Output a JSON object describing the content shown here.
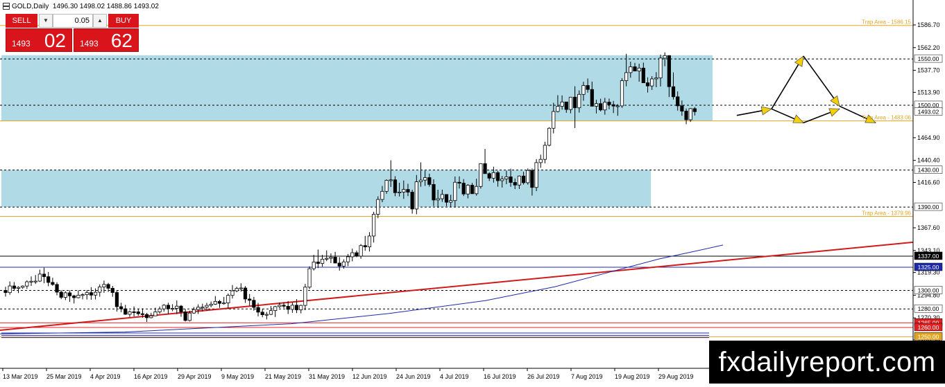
{
  "header": {
    "symbol": "GOLD,Daily",
    "open": "1496.30",
    "high": "1498.02",
    "low": "1488.86",
    "close": "1493.02"
  },
  "trade_panel": {
    "sell_label": "SELL",
    "buy_label": "BUY",
    "lot": "0.05",
    "down_arrow": "▼",
    "up_arrow": "▲",
    "bid_small": "1493",
    "bid_big": "02",
    "ask_small": "1493",
    "ask_big": "62"
  },
  "colors": {
    "sell_buy": "#d9141b",
    "zone": "#add8e6",
    "trend": "#d11a1a",
    "ma": "#1c2aa8",
    "trap": "#e3a520",
    "level_black": "#000000",
    "level_blue": "#1c2aa8",
    "level_red": "#e02020",
    "arrow": "#f5d000"
  },
  "chart_data": {
    "type": "candlestick",
    "symbol": "GOLD",
    "timeframe": "Daily",
    "ylim": [
      1242,
      1600
    ],
    "y_ticks": [
      "1586.70",
      "1562.20",
      "1537.70",
      "1513.90",
      "1464.90",
      "1440.40",
      "1416.60",
      "1367.60",
      "1343.10",
      "1319.30",
      "1294.80",
      "1270.30",
      "1246.50"
    ],
    "x_ticks": [
      "13 Mar 2019",
      "25 Mar 2019",
      "4 Apr 2019",
      "16 Apr 2019",
      "29 Apr 2019",
      "9 May 2019",
      "21 May 2019",
      "31 May 2019",
      "12 Jun 2019",
      "24 Jun 2019",
      "4 Jul 2019",
      "16 Jul 2019",
      "26 Jul 2019",
      "7 Aug 2019",
      "19 Aug 2019",
      "29 Aug 2019"
    ],
    "current_price": "1493.02",
    "levels": [
      {
        "value": 1550.0,
        "label": "1550.00",
        "color": "black",
        "style": "dashed"
      },
      {
        "value": 1500.0,
        "label": "1500.00",
        "color": "black",
        "style": "dashed"
      },
      {
        "value": 1430.0,
        "label": "1430.00",
        "color": "black",
        "style": "dashed"
      },
      {
        "value": 1390.0,
        "label": "1390.00",
        "color": "black",
        "style": "dashed"
      },
      {
        "value": 1337.0,
        "label": "1337.00",
        "color": "black",
        "style": "solid"
      },
      {
        "value": 1325.0,
        "label": "1325.00",
        "color": "blue",
        "style": "solid"
      },
      {
        "value": 1300.0,
        "label": "1300.00",
        "color": "black",
        "style": "dashed"
      },
      {
        "value": 1280.0,
        "label": "1280.00",
        "color": "black",
        "style": "dashed"
      },
      {
        "value": 1265.0,
        "label": "1265.00",
        "color": "red",
        "style": "solid"
      },
      {
        "value": 1260.0,
        "label": "1260.00",
        "color": "red",
        "style": "solid"
      },
      {
        "value": 1250.0,
        "label": "1250.00",
        "color": "trap",
        "style": "solid"
      }
    ],
    "trap_areas": [
      {
        "value": 1586.15,
        "label": "Trap Area - 1586.15"
      },
      {
        "value": 1483.06,
        "label": "Trap Area - 1483.06"
      },
      {
        "value": 1379.96,
        "label": "Trap Area - 1379.96"
      }
    ],
    "zones": [
      {
        "from": 1483.06,
        "to": 1554.0,
        "x_end": 1027
      },
      {
        "from": 1390.0,
        "to": 1430.0,
        "x_end": 938
      }
    ],
    "trendline": {
      "x1": 0,
      "y1": 1257,
      "x2": 1316,
      "y2": 1352
    },
    "moving_average": [
      [
        0,
        1253
      ],
      [
        180,
        1255
      ],
      [
        420,
        1264
      ],
      [
        560,
        1275
      ],
      [
        700,
        1289
      ],
      [
        800,
        1304
      ],
      [
        880,
        1320
      ],
      [
        950,
        1334
      ],
      [
        1000,
        1342
      ],
      [
        1042,
        1349
      ]
    ],
    "projection": [
      [
        1062,
        1489
      ],
      [
        1112,
        1496
      ],
      [
        1158,
        1553
      ],
      [
        1210,
        1499
      ],
      [
        1262,
        1481
      ]
    ],
    "projection_alt": [
      [
        1112,
        1496
      ],
      [
        1158,
        1481
      ],
      [
        1210,
        1496
      ]
    ],
    "candles": [
      [
        1300.0,
        1303.9,
        1293.3,
        1297.6
      ],
      [
        1297.6,
        1309.7,
        1295.3,
        1304.8
      ],
      [
        1304.8,
        1309.0,
        1300.2,
        1302.2
      ],
      [
        1302.2,
        1304.5,
        1297.1,
        1303.3
      ],
      [
        1303.3,
        1305.4,
        1301.7,
        1304.7
      ],
      [
        1304.7,
        1310.8,
        1301.6,
        1309.3
      ],
      [
        1309.3,
        1315.1,
        1304.8,
        1309.9
      ],
      [
        1309.9,
        1316.6,
        1306.9,
        1310.0
      ],
      [
        1310.0,
        1322.4,
        1309.1,
        1317.6
      ],
      [
        1317.6,
        1324.5,
        1307.7,
        1314.8
      ],
      [
        1314.8,
        1319.9,
        1304.5,
        1308.6
      ],
      [
        1308.6,
        1313.6,
        1304.9,
        1306.4
      ],
      [
        1306.4,
        1308.8,
        1294.7,
        1298.1
      ],
      [
        1298.1,
        1300.1,
        1290.5,
        1292.5
      ],
      [
        1292.5,
        1299.1,
        1289.5,
        1297.4
      ],
      [
        1297.4,
        1300.1,
        1287.5,
        1294.1
      ],
      [
        1294.1,
        1295.3,
        1285.9,
        1292.1
      ],
      [
        1292.1,
        1300.1,
        1291.4,
        1294.8
      ],
      [
        1294.8,
        1296.9,
        1290.3,
        1295.4
      ],
      [
        1295.4,
        1300.2,
        1290.2,
        1297.6
      ],
      [
        1297.6,
        1303.5,
        1289.9,
        1294.9
      ],
      [
        1294.9,
        1302.2,
        1290.2,
        1298.0
      ],
      [
        1298.0,
        1306.5,
        1293.2,
        1303.7
      ],
      [
        1303.7,
        1310.6,
        1297.3,
        1306.4
      ],
      [
        1306.4,
        1308.1,
        1298.4,
        1302.3
      ],
      [
        1302.3,
        1304.8,
        1293.1,
        1297.7
      ],
      [
        1297.7,
        1300.2,
        1277.2,
        1282.4
      ],
      [
        1282.4,
        1286.6,
        1276.5,
        1280.1
      ],
      [
        1280.1,
        1284.4,
        1273.6,
        1274.2
      ],
      [
        1274.2,
        1278.4,
        1271.4,
        1276.9
      ],
      [
        1276.9,
        1282.7,
        1271.8,
        1276.8
      ],
      [
        1276.8,
        1279.8,
        1272.6,
        1274.8
      ],
      [
        1274.8,
        1280.6,
        1270.6,
        1274.0
      ],
      [
        1274.0,
        1275.7,
        1265.9,
        1270.5
      ],
      [
        1270.5,
        1275.8,
        1269.8,
        1272.5
      ],
      [
        1272.5,
        1281.3,
        1272.2,
        1276.8
      ],
      [
        1276.8,
        1282.6,
        1274.9,
        1280.0
      ],
      [
        1280.0,
        1285.1,
        1277.0,
        1284.0
      ],
      [
        1284.0,
        1286.7,
        1274.3,
        1280.1
      ],
      [
        1280.1,
        1285.1,
        1277.5,
        1280.6
      ],
      [
        1280.6,
        1289.1,
        1274.4,
        1283.0
      ],
      [
        1283.0,
        1284.2,
        1271.5,
        1276.8
      ],
      [
        1276.8,
        1279.8,
        1266.4,
        1267.5
      ],
      [
        1267.5,
        1278.0,
        1266.4,
        1275.5
      ],
      [
        1275.5,
        1282.0,
        1274.8,
        1279.3
      ],
      [
        1279.3,
        1284.9,
        1274.5,
        1281.8
      ],
      [
        1281.8,
        1285.6,
        1277.4,
        1281.9
      ],
      [
        1281.9,
        1286.5,
        1278.1,
        1283.8
      ],
      [
        1283.8,
        1288.0,
        1281.8,
        1285.1
      ],
      [
        1285.1,
        1293.9,
        1284.4,
        1288.1
      ],
      [
        1288.1,
        1289.7,
        1281.2,
        1286.0
      ],
      [
        1286.0,
        1292.9,
        1284.5,
        1286.5
      ],
      [
        1286.5,
        1296.6,
        1279.8,
        1294.6
      ],
      [
        1294.6,
        1305.8,
        1291.2,
        1299.5
      ],
      [
        1299.5,
        1303.9,
        1298.0,
        1302.1
      ],
      [
        1302.1,
        1307.6,
        1298.7,
        1302.6
      ],
      [
        1302.6,
        1304.7,
        1286.6,
        1290.7
      ],
      [
        1290.7,
        1296.1,
        1283.5,
        1289.3
      ],
      [
        1289.3,
        1293.0,
        1278.1,
        1281.6
      ],
      [
        1281.6,
        1286.5,
        1271.9,
        1276.5
      ],
      [
        1276.5,
        1279.6,
        1271.0,
        1273.7
      ],
      [
        1273.7,
        1276.7,
        1268.7,
        1274.1
      ],
      [
        1274.1,
        1283.1,
        1273.3,
        1278.2
      ],
      [
        1278.2,
        1283.4,
        1271.3,
        1282.5
      ],
      [
        1282.5,
        1286.8,
        1280.9,
        1284.0
      ],
      [
        1284.0,
        1287.2,
        1280.9,
        1282.9
      ],
      [
        1282.9,
        1288.5,
        1274.5,
        1279.5
      ],
      [
        1279.5,
        1287.0,
        1275.8,
        1284.0
      ],
      [
        1284.0,
        1290.5,
        1275.5,
        1279.0
      ],
      [
        1279.0,
        1284.6,
        1275.2,
        1283.8
      ],
      [
        1283.8,
        1307.0,
        1278.6,
        1303.5
      ],
      [
        1303.5,
        1326.0,
        1301.5,
        1323.4
      ],
      [
        1323.4,
        1338.4,
        1321.5,
        1330.7
      ],
      [
        1330.7,
        1344.1,
        1324.1,
        1329.0
      ],
      [
        1329.0,
        1338.4,
        1325.6,
        1333.7
      ],
      [
        1333.7,
        1343.2,
        1331.6,
        1334.6
      ],
      [
        1334.6,
        1339.9,
        1329.5,
        1335.9
      ],
      [
        1335.9,
        1341.6,
        1330.3,
        1329.5
      ],
      [
        1329.5,
        1335.9,
        1321.4,
        1326.2
      ],
      [
        1326.2,
        1333.5,
        1323.4,
        1330.8
      ],
      [
        1330.8,
        1339.3,
        1326.2,
        1336.3
      ],
      [
        1336.3,
        1345.0,
        1331.4,
        1340.7
      ],
      [
        1340.7,
        1343.0,
        1335.9,
        1337.0
      ],
      [
        1337.0,
        1350.1,
        1334.2,
        1348.4
      ],
      [
        1348.4,
        1358.8,
        1342.7,
        1347.0
      ],
      [
        1347.0,
        1362.9,
        1342.0,
        1358.7
      ],
      [
        1358.7,
        1384.9,
        1351.7,
        1382.2
      ],
      [
        1382.2,
        1401.6,
        1378.0,
        1398.2
      ],
      [
        1398.2,
        1412.8,
        1395.2,
        1407.0
      ],
      [
        1407.0,
        1419.9,
        1404.3,
        1418.9
      ],
      [
        1418.9,
        1440.5,
        1411.7,
        1419.4
      ],
      [
        1419.4,
        1423.3,
        1401.7,
        1405.5
      ],
      [
        1405.5,
        1416.2,
        1401.4,
        1406.2
      ],
      [
        1406.2,
        1418.7,
        1398.8,
        1409.0
      ],
      [
        1409.0,
        1415.1,
        1401.8,
        1406.1
      ],
      [
        1406.1,
        1408.7,
        1382.9,
        1387.9
      ],
      [
        1387.9,
        1424.6,
        1382.2,
        1417.3
      ],
      [
        1417.3,
        1438.3,
        1412.0,
        1419.1
      ],
      [
        1419.1,
        1429.3,
        1412.9,
        1421.8
      ],
      [
        1421.8,
        1426.1,
        1412.0,
        1414.4
      ],
      [
        1414.4,
        1420.0,
        1391.1,
        1397.6
      ],
      [
        1397.6,
        1408.7,
        1389.2,
        1399.0
      ],
      [
        1399.0,
        1408.8,
        1395.6,
        1403.6
      ],
      [
        1403.6,
        1403.2,
        1390.9,
        1395.2
      ],
      [
        1395.2,
        1403.3,
        1390.2,
        1397.0
      ],
      [
        1397.0,
        1423.0,
        1390.4,
        1416.8
      ],
      [
        1416.8,
        1423.1,
        1410.0,
        1415.8
      ],
      [
        1415.8,
        1420.2,
        1401.9,
        1404.1
      ],
      [
        1404.1,
        1414.7,
        1399.4,
        1413.6
      ],
      [
        1413.6,
        1416.1,
        1406.7,
        1404.4
      ],
      [
        1404.4,
        1420.6,
        1402.3,
        1412.3
      ],
      [
        1412.3,
        1437.3,
        1410.0,
        1436.9
      ],
      [
        1436.9,
        1452.8,
        1431.6,
        1426.1
      ],
      [
        1426.1,
        1427.4,
        1418.2,
        1421.2
      ],
      [
        1421.2,
        1433.6,
        1416.4,
        1427.2
      ],
      [
        1427.2,
        1429.0,
        1412.0,
        1418.5
      ],
      [
        1418.5,
        1423.6,
        1411.1,
        1420.4
      ],
      [
        1420.4,
        1429.3,
        1414.7,
        1422.6
      ],
      [
        1422.6,
        1431.4,
        1411.9,
        1416.6
      ],
      [
        1416.6,
        1420.9,
        1409.4,
        1413.8
      ],
      [
        1413.8,
        1424.1,
        1409.5,
        1423.5
      ],
      [
        1423.5,
        1428.2,
        1414.3,
        1416.3
      ],
      [
        1416.3,
        1431.7,
        1414.2,
        1429.5
      ],
      [
        1429.5,
        1431.6,
        1402.4,
        1411.2
      ],
      [
        1411.2,
        1441.8,
        1407.2,
        1438.0
      ],
      [
        1438.0,
        1446.6,
        1432.4,
        1441.5
      ],
      [
        1441.5,
        1460.5,
        1437.1,
        1456.7
      ],
      [
        1456.7,
        1476.2,
        1455.6,
        1475.1
      ],
      [
        1475.1,
        1502.6,
        1469.6,
        1493.2
      ],
      [
        1493.2,
        1510.8,
        1492.2,
        1498.8
      ],
      [
        1498.8,
        1510.6,
        1495.2,
        1503.5
      ],
      [
        1503.5,
        1503.2,
        1491.8,
        1495.4
      ],
      [
        1495.4,
        1506.1,
        1491.2,
        1508.7
      ],
      [
        1508.7,
        1520.5,
        1475.3,
        1497.2
      ],
      [
        1497.2,
        1516.0,
        1492.0,
        1511.7
      ],
      [
        1511.7,
        1525.3,
        1504.8,
        1521.3
      ],
      [
        1521.3,
        1528.8,
        1513.6,
        1517.0
      ],
      [
        1517.0,
        1525.5,
        1505.6,
        1498.9
      ],
      [
        1498.9,
        1505.9,
        1491.0,
        1501.7
      ],
      [
        1501.7,
        1507.0,
        1493.3,
        1494.9
      ],
      [
        1494.9,
        1507.9,
        1489.8,
        1503.3
      ],
      [
        1503.3,
        1507.1,
        1495.6,
        1500.6
      ],
      [
        1500.6,
        1504.6,
        1491.5,
        1499.1
      ],
      [
        1499.1,
        1501.2,
        1488.6,
        1499.3
      ],
      [
        1499.3,
        1529.2,
        1497.1,
        1526.5
      ],
      [
        1526.5,
        1555.5,
        1520.4,
        1535.2
      ],
      [
        1535.2,
        1547.0,
        1529.7,
        1541.5
      ],
      [
        1541.5,
        1545.7,
        1537.4,
        1536.9
      ],
      [
        1536.9,
        1544.8,
        1525.4,
        1540.1
      ],
      [
        1540.1,
        1546.0,
        1529.5,
        1524.2
      ],
      [
        1524.2,
        1530.1,
        1513.7,
        1520.8
      ],
      [
        1520.8,
        1531.3,
        1516.5,
        1528.4
      ],
      [
        1528.4,
        1535.7,
        1519.4,
        1529.5
      ],
      [
        1529.5,
        1554.6,
        1520.2,
        1550.9
      ],
      [
        1550.9,
        1557.1,
        1542.1,
        1553.6
      ],
      [
        1553.6,
        1553.4,
        1508.8,
        1520.0
      ],
      [
        1520.0,
        1535.4,
        1506.1,
        1509.1
      ],
      [
        1509.1,
        1514.9,
        1494.2,
        1499.3
      ],
      [
        1499.3,
        1505.1,
        1488.6,
        1493.6
      ],
      [
        1493.6,
        1496.4,
        1479.4,
        1484.3
      ],
      [
        1484.3,
        1496.9,
        1481.9,
        1496.3
      ],
      [
        1496.3,
        1498.0,
        1488.9,
        1493.0
      ]
    ]
  },
  "branding": {
    "text": "fxdailyreport.com"
  }
}
